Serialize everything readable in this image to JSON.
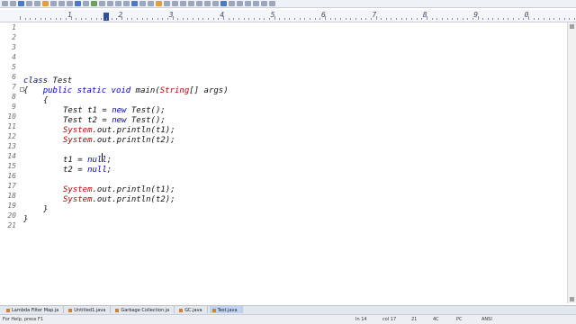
{
  "ruler": {
    "numbers": [
      "1",
      "2",
      "3",
      "4",
      "5",
      "6",
      "7",
      "8",
      "9",
      "0"
    ]
  },
  "gutter": {
    "line_numbers": [
      "1",
      "2",
      "3",
      "4",
      "5",
      "6",
      "7",
      "8",
      "9",
      "10",
      "11",
      "12",
      "13",
      "14",
      "15",
      "16",
      "17",
      "18",
      "19",
      "20",
      "21"
    ]
  },
  "code": {
    "line6": {
      "kw": "class",
      "rest": " Test"
    },
    "line7": {
      "brace": "{",
      "kw": "public static void",
      "rest": " main(",
      "type": "String",
      "tail": "[] args)"
    },
    "line8": "{",
    "line9": {
      "a": "Test t1 = ",
      "kw": "new",
      "b": " Test();"
    },
    "line10": {
      "a": "Test t2 = ",
      "kw": "new",
      "b": " Test();"
    },
    "line11": {
      "sys": "System",
      "rest": ".out.println(t1);"
    },
    "line12": {
      "sys": "System",
      "rest": ".out.println(t2);"
    },
    "line14": {
      "a": "t1 = ",
      "kw": "null",
      "b": ";"
    },
    "line15": {
      "a": "t2 = ",
      "kw": "null",
      "b": ";"
    },
    "line17": {
      "sys": "System",
      "rest": ".out.println(t1);"
    },
    "line18": {
      "sys": "System",
      "rest": ".out.println(t2);"
    },
    "line19": "}",
    "line20": "}"
  },
  "tabs": [
    "Lambda Filter Map.ja",
    "Untitled1.java",
    "Garbage Collection.ja",
    "GC.java",
    "Test.java"
  ],
  "status": {
    "help": "For Help, press F1",
    "ln": "In 14",
    "col": "col 17",
    "n1": "21",
    "n2": "4C",
    "mode": "PC",
    "enc": "ANSI"
  },
  "colors": {
    "keyword": "#0000cc",
    "system": "#c00000",
    "active_tab": "#bfd4f2"
  }
}
